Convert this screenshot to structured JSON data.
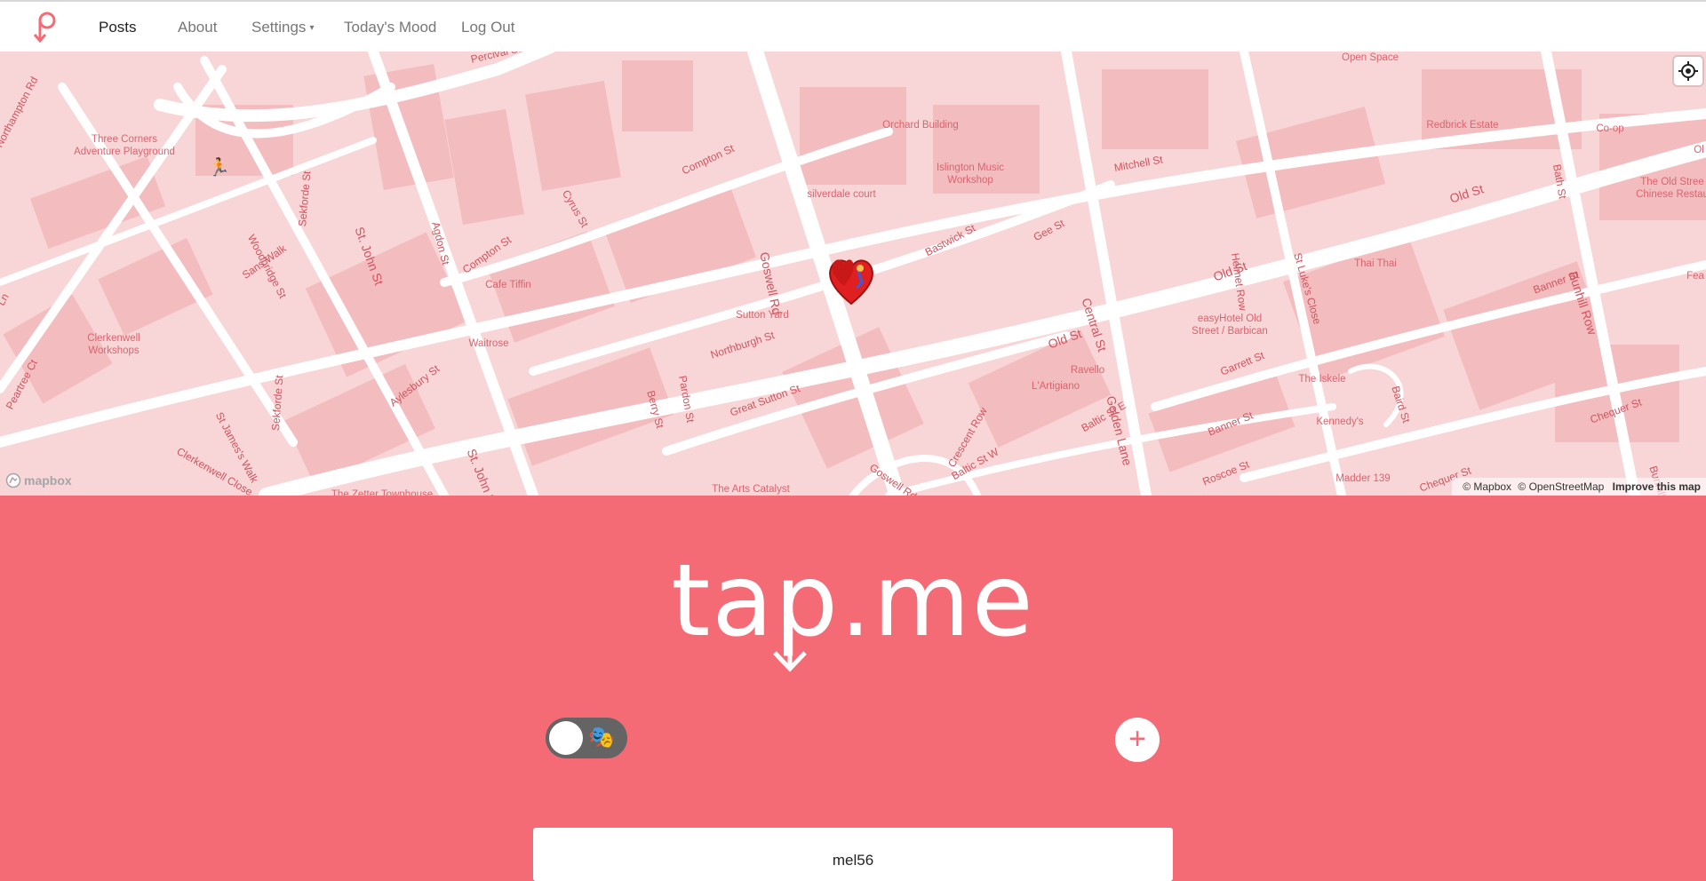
{
  "nav": {
    "items": [
      {
        "label": "Posts"
      },
      {
        "label": "About"
      },
      {
        "label": "Settings",
        "caret": "▾"
      },
      {
        "label": "Today's Mood"
      },
      {
        "label": "Log Out"
      }
    ],
    "brand_color": "#f46b75"
  },
  "map": {
    "streets": [
      "Percival St",
      "Northampton Rd",
      "Woodbridge St",
      "Sekforde St",
      "St. John St",
      "Agdon St",
      "Cyrus St",
      "Compton St",
      "Compton St",
      "Goswell Rd",
      "Bastwick St",
      "Gee St",
      "Mitchell St",
      "Central St",
      "Helmet Row",
      "St Luke's Close",
      "Old St",
      "Old St",
      "Old St",
      "Bath St",
      "Bunhill Row",
      "Banner St",
      "Sans Walk",
      "St James's Walk",
      "Pardon St",
      "Northburgh St",
      "Berry St",
      "Great Sutton St",
      "Aylesbury St",
      "St. John St",
      "Sekforde St",
      "Peartree Ct",
      "Clerkenwell Close",
      "Golden Lane",
      "Baltic St E",
      "Crescent Row",
      "Baltic St W",
      "Garrett St",
      "Banner St",
      "Baird St",
      "Roscoe St",
      "Chequer St",
      "Chequer St",
      "Bunhill Row",
      "Goswell Rd",
      "Ln"
    ],
    "pois": [
      "Three Corners\nAdventure Playground",
      "Orchard Building",
      "Islington Music\nWorkshop",
      "silverdale court",
      "Open Space",
      "Redbrick Estate",
      "Co-op",
      "The Old Stree\nChinese Restau",
      "Thai Thai",
      "easyHotel Old\nStreet / Barbican",
      "Cafe Tiffin",
      "Sutton Yard",
      "Waitrose",
      "Clerkenwell\nWorkshops",
      "Ravello",
      "L'Artigiano",
      "The Iskele",
      "Kennedy's",
      "Madder 139",
      "The Arts Catalyst",
      "The Zetter Townhouse",
      "Fea",
      "Ol"
    ],
    "mapbox_logo": "mapbox",
    "attribution": [
      "© Mapbox",
      "© OpenStreetMap"
    ],
    "improve_link": "Improve this map",
    "icons": {
      "locate": "locate-icon",
      "runner": "runner-emoji",
      "heart": "heart-marker-icon"
    },
    "runner_glyph": "🏃"
  },
  "hero": {
    "brand_text": "tap.me",
    "toggle_glyph": "🎭",
    "add_glyph": "+"
  },
  "card": {
    "username": "mel56"
  },
  "colors": {
    "accent": "#f46b75",
    "map_base": "#f8d5d6",
    "map_road": "#ffffff",
    "map_label": "#cf5560"
  }
}
